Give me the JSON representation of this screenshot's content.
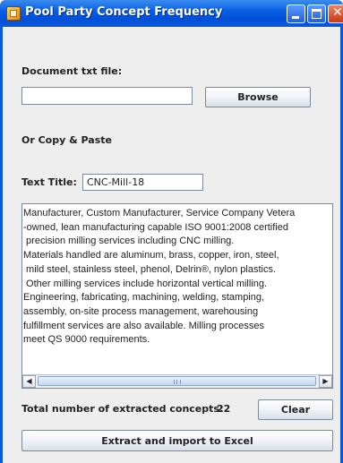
{
  "window": {
    "title": "Pool Party Concept Frequency"
  },
  "document_file": {
    "label": "Document txt file:",
    "value": "",
    "browse_label": "Browse"
  },
  "copy_paste_label": "Or Copy & Paste",
  "text_title": {
    "label": "Text Title:",
    "value": "CNC-Mill-18"
  },
  "text_area": {
    "lines": [
      "Manufacturer, Custom Manufacturer, Service Company Vetera",
      "-owned, lean manufacturing capable ISO 9001:2008 certified",
      " precision milling services including CNC milling.",
      "Materials handled are aluminum, brass, copper, iron, steel,",
      " mild steel, stainless steel, phenol, Delrin®, nylon plastics.",
      " Other milling services include horizontal vertical milling.",
      "Engineering, fabricating, machining, welding, stamping,",
      "assembly, on-site process management, warehousing",
      "fulfillment services are also available. Milling processes",
      "meet QS 9000 requirements."
    ],
    "hscroll_position": 0.0
  },
  "extracted": {
    "label": "Total number of extracted concepts:",
    "count": "22",
    "clear_label": "Clear"
  },
  "extract_button_label": "Extract and import to Excel",
  "icons": {
    "app": "pool-party-app-icon",
    "minimize": "minimize-icon",
    "maximize": "maximize-icon",
    "close": "close-icon",
    "scroll_left": "arrow-left-icon",
    "scroll_right": "arrow-right-icon"
  },
  "colors": {
    "titlebar": "#0a58dc",
    "panel_background": "#eeeeee"
  }
}
